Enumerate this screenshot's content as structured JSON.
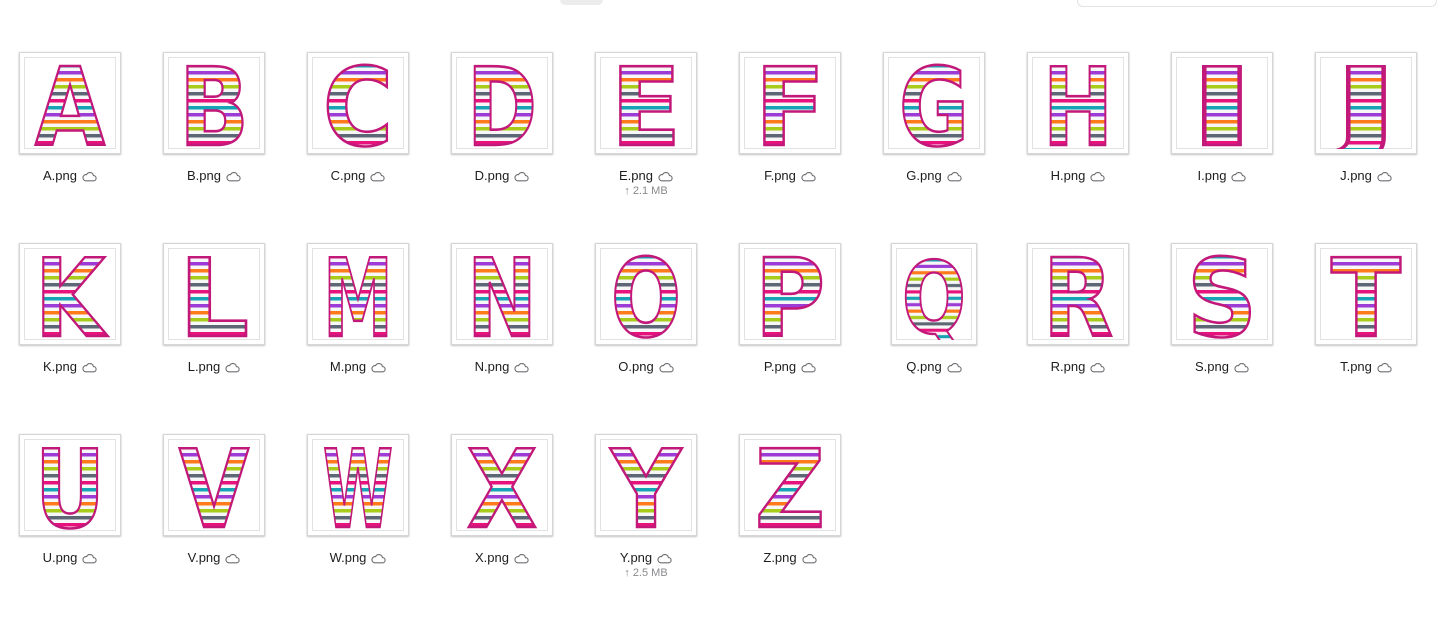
{
  "files": [
    {
      "name": "A.png",
      "letter": "A",
      "status": "cloud-icon"
    },
    {
      "name": "B.png",
      "letter": "B",
      "status": "cloud-icon"
    },
    {
      "name": "C.png",
      "letter": "C",
      "status": "cloud-icon"
    },
    {
      "name": "D.png",
      "letter": "D",
      "status": "cloud-icon"
    },
    {
      "name": "E.png",
      "letter": "E",
      "status": "cloud-icon",
      "upload": "2.1 MB"
    },
    {
      "name": "F.png",
      "letter": "F",
      "status": "cloud-icon"
    },
    {
      "name": "G.png",
      "letter": "G",
      "status": "cloud-icon"
    },
    {
      "name": "H.png",
      "letter": "H",
      "status": "cloud-icon"
    },
    {
      "name": "I.png",
      "letter": "I",
      "status": "cloud-icon"
    },
    {
      "name": "J.png",
      "letter": "J",
      "status": "cloud-icon"
    },
    {
      "name": "K.png",
      "letter": "K",
      "status": "cloud-icon"
    },
    {
      "name": "L.png",
      "letter": "L",
      "status": "cloud-icon"
    },
    {
      "name": "M.png",
      "letter": "M",
      "status": "cloud-icon"
    },
    {
      "name": "N.png",
      "letter": "N",
      "status": "cloud-icon"
    },
    {
      "name": "O.png",
      "letter": "O",
      "status": "cloud-icon"
    },
    {
      "name": "P.png",
      "letter": "P",
      "status": "cloud-icon"
    },
    {
      "name": "Q.png",
      "letter": "Q",
      "status": "cloud-icon"
    },
    {
      "name": "R.png",
      "letter": "R",
      "status": "cloud-icon"
    },
    {
      "name": "S.png",
      "letter": "S",
      "status": "cloud-icon"
    },
    {
      "name": "T.png",
      "letter": "T",
      "status": "cloud-icon"
    },
    {
      "name": "U.png",
      "letter": "U",
      "status": "cloud-icon"
    },
    {
      "name": "V.png",
      "letter": "V",
      "status": "cloud-icon"
    },
    {
      "name": "W.png",
      "letter": "W",
      "status": "cloud-icon"
    },
    {
      "name": "X.png",
      "letter": "X",
      "status": "cloud-icon"
    },
    {
      "name": "Y.png",
      "letter": "Y",
      "status": "cloud-icon",
      "upload": "2.5 MB"
    },
    {
      "name": "Z.png",
      "letter": "Z",
      "status": "cloud-icon"
    }
  ],
  "stripe_colors": [
    "#e8127c",
    "#f7f7f7",
    "#16a3b5",
    "#f7f7f7",
    "#9d3bd6",
    "#f7f7f7",
    "#ff7a1a",
    "#f7f7f7",
    "#a9cc1a",
    "#f7f7f7",
    "#5d6675",
    "#f7f7f7"
  ],
  "outline_color": "#c2187a",
  "upload_arrow": "↑"
}
